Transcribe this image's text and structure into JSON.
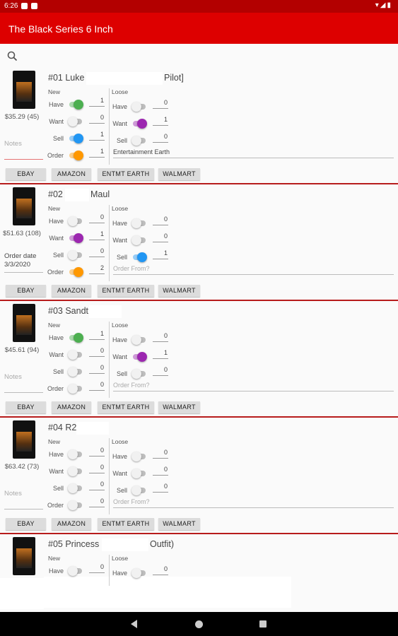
{
  "status_bar": {
    "time": "6:26",
    "right_icons": "▾◢▮"
  },
  "app_bar": {
    "title": "The Black Series 6 Inch"
  },
  "search": {
    "icon": "search-icon"
  },
  "buttons": {
    "ebay": "EBAY",
    "amazon": "AMAZON",
    "entmt": "ENTMT EARTH",
    "walmart": "WALMART"
  },
  "labels": {
    "new": "New",
    "loose": "Loose",
    "have": "Have",
    "want": "Want",
    "sell": "Sell",
    "order": "Order",
    "notes": "Notes",
    "order_from": "Order From?"
  },
  "colors": {
    "have": "#4caf50",
    "want": "#9c27b0",
    "sell": "#2196f3",
    "order": "#ff9800",
    "app_bar": "#dd0000"
  },
  "items": [
    {
      "name_parts": [
        "#01 Luke",
        "Pilot]"
      ],
      "price": "$35.29 (45)",
      "notes": "Notes",
      "new": {
        "have": {
          "on": true,
          "qty": "1"
        },
        "want": {
          "on": false,
          "qty": "0"
        },
        "sell": {
          "on": true,
          "qty": "1"
        },
        "order": {
          "on": true,
          "qty": "1"
        }
      },
      "loose": {
        "have": {
          "on": false,
          "qty": "0"
        },
        "want": {
          "on": true,
          "qty": "1"
        },
        "sell": {
          "on": false,
          "qty": "0"
        }
      },
      "order_from": "Entertainment Earth"
    },
    {
      "name_parts": [
        "#02",
        "Maul"
      ],
      "price": "$51.63 (108)",
      "notes": "Order date 3/3/2020",
      "new": {
        "have": {
          "on": false,
          "qty": "0"
        },
        "want": {
          "on": true,
          "qty": "1"
        },
        "sell": {
          "on": false,
          "qty": "0"
        },
        "order": {
          "on": true,
          "qty": "2"
        }
      },
      "loose": {
        "have": {
          "on": false,
          "qty": "0"
        },
        "want": {
          "on": false,
          "qty": "0"
        },
        "sell": {
          "on": true,
          "qty": "1"
        }
      },
      "order_from": ""
    },
    {
      "name_parts": [
        "#03 Sandt",
        ""
      ],
      "price": "$45.61 (94)",
      "notes": "Notes",
      "new": {
        "have": {
          "on": true,
          "qty": "1"
        },
        "want": {
          "on": false,
          "qty": "0"
        },
        "sell": {
          "on": false,
          "qty": "0"
        },
        "order": {
          "on": false,
          "qty": "0"
        }
      },
      "loose": {
        "have": {
          "on": false,
          "qty": "0"
        },
        "want": {
          "on": true,
          "qty": "1"
        },
        "sell": {
          "on": false,
          "qty": "0"
        }
      },
      "order_from": ""
    },
    {
      "name_parts": [
        "#04 R2",
        ""
      ],
      "price": "$63.42 (73)",
      "notes": "Notes",
      "new": {
        "have": {
          "on": false,
          "qty": "0"
        },
        "want": {
          "on": false,
          "qty": "0"
        },
        "sell": {
          "on": false,
          "qty": "0"
        },
        "order": {
          "on": false,
          "qty": "0"
        }
      },
      "loose": {
        "have": {
          "on": false,
          "qty": "0"
        },
        "want": {
          "on": false,
          "qty": "0"
        },
        "sell": {
          "on": false,
          "qty": "0"
        }
      },
      "order_from": ""
    },
    {
      "name_parts": [
        "#05 Princess",
        "Outfit)"
      ],
      "price": "",
      "notes": "",
      "new": {
        "have": {
          "on": false,
          "qty": "0"
        }
      },
      "loose": {
        "have": {
          "on": false,
          "qty": "0"
        }
      },
      "order_from": ""
    }
  ],
  "nav": {
    "back": "nav-back-icon",
    "home": "nav-home-icon",
    "recent": "nav-recent-icon"
  }
}
